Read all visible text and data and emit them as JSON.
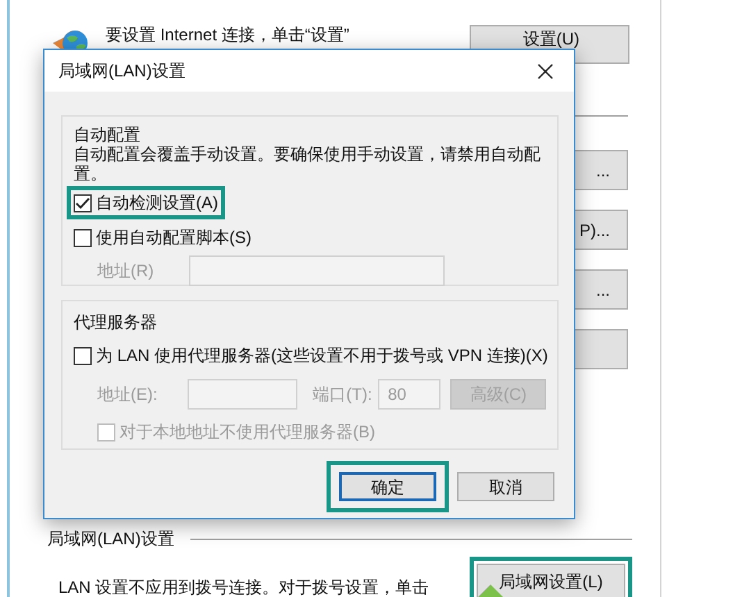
{
  "background_window": {
    "internet_setup": {
      "text": "要设置 Internet 连接，单击“设置”",
      "button": "设置(U)"
    },
    "side_buttons": [
      {
        "label": "..."
      },
      {
        "label": "P)..."
      },
      {
        "label": "..."
      }
    ],
    "lan_section": {
      "title": "局域网(LAN)设置",
      "text": "LAN 设置不应用到拨号连接。对于拨号设置，单击",
      "button": {
        "label": "局域网设置(L)",
        "highlighted": true
      }
    }
  },
  "dialog": {
    "title": "局域网(LAN)设置",
    "auto_config": {
      "title": "自动配置",
      "description": "自动配置会覆盖手动设置。要确保使用手动设置，请禁用自动配置。",
      "options": [
        {
          "label": "自动检测设置(A)",
          "checked": true,
          "disabled": false,
          "highlighted": true
        },
        {
          "label": "使用自动配置脚本(S)",
          "checked": false,
          "disabled": false,
          "highlighted": false
        }
      ],
      "address": {
        "label": "地址(R)",
        "disabled": true
      }
    },
    "proxy": {
      "title": "代理服务器",
      "use_proxy": {
        "label": "为 LAN 使用代理服务器(这些设置不用于拨号或 VPN 连接)(X)",
        "checked": false,
        "disabled": false
      },
      "address": {
        "label": "地址(E):",
        "disabled": true
      },
      "port": {
        "label": "端口(T):",
        "value": "80",
        "disabled": true
      },
      "advanced_button": {
        "label": "高级(C)",
        "disabled": true
      },
      "bypass_local": {
        "label": "对于本地地址不使用代理服务器(B)",
        "checked": false,
        "disabled": true
      }
    },
    "buttons": [
      {
        "label": "确定",
        "focused": true,
        "highlighted": true
      },
      {
        "label": "取消",
        "focused": false,
        "highlighted": false
      }
    ]
  }
}
